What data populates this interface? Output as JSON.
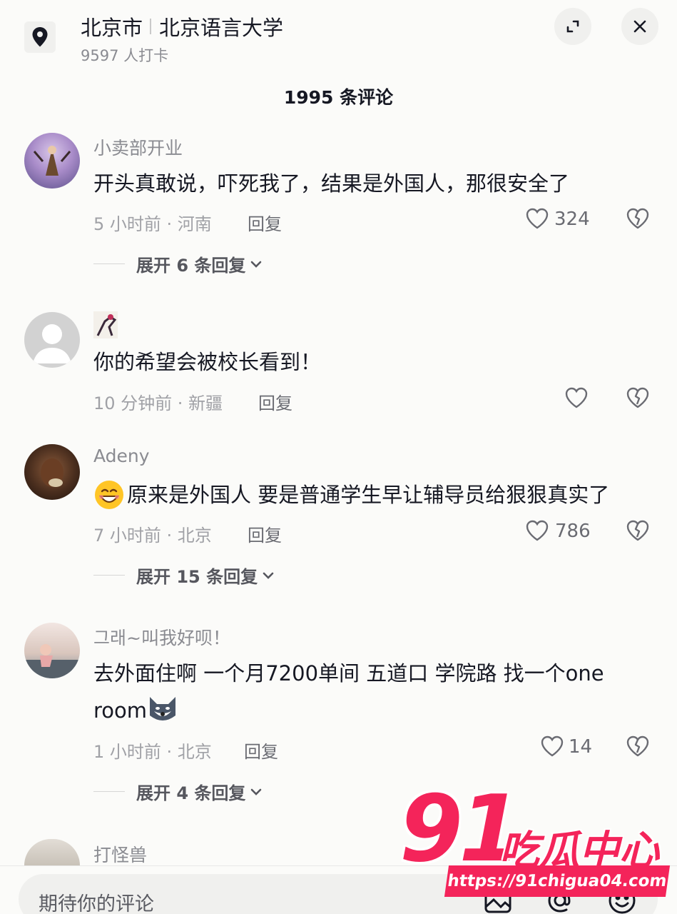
{
  "header": {
    "location_city": "北京市",
    "location_name": "北京语言大学",
    "checkin_count": "9597 人打卡",
    "icons": {
      "location": "location-pin-icon",
      "expand": "expand-icon",
      "close": "close-icon"
    }
  },
  "comments_title": "1995 条评论",
  "comments": [
    {
      "username": "小卖部开业",
      "content": "开头真敢说，吓死我了，结果是外国人，那很安全了",
      "meta": "5 小时前 · 河南",
      "reply_label": "回复",
      "likes": "324",
      "expand_label": "展开 6 条回复"
    },
    {
      "username": "",
      "content": "你的希望会被校长看到！",
      "meta": "10 分钟前 · 新疆",
      "reply_label": "回复",
      "likes": ""
    },
    {
      "username": "Adeny",
      "content": "原来是外国人 要是普通学生早让辅导员给狠狠真实了",
      "meta": "7 小时前 · 北京",
      "reply_label": "回复",
      "likes": "786",
      "expand_label": "展开 15 条回复"
    },
    {
      "username": "그래~叫我好呗！",
      "content_line1": "去外面住啊 一个月7200单间 五道口 学院路 找一个one",
      "content_line2": "room",
      "meta": "1 小时前 · 北京",
      "reply_label": "回复",
      "likes": "14",
      "expand_label": "展开 4 条回复"
    },
    {
      "username": "打怪兽"
    }
  ],
  "input": {
    "placeholder": "期待你的评论"
  },
  "watermark": {
    "number": "91",
    "brand": "吃瓜中心",
    "url": "https://91chigua04.com"
  },
  "colors": {
    "accent": "#f4245a",
    "text": "#161823",
    "muted": "#8a8b91",
    "background": "#fbfbf9"
  }
}
